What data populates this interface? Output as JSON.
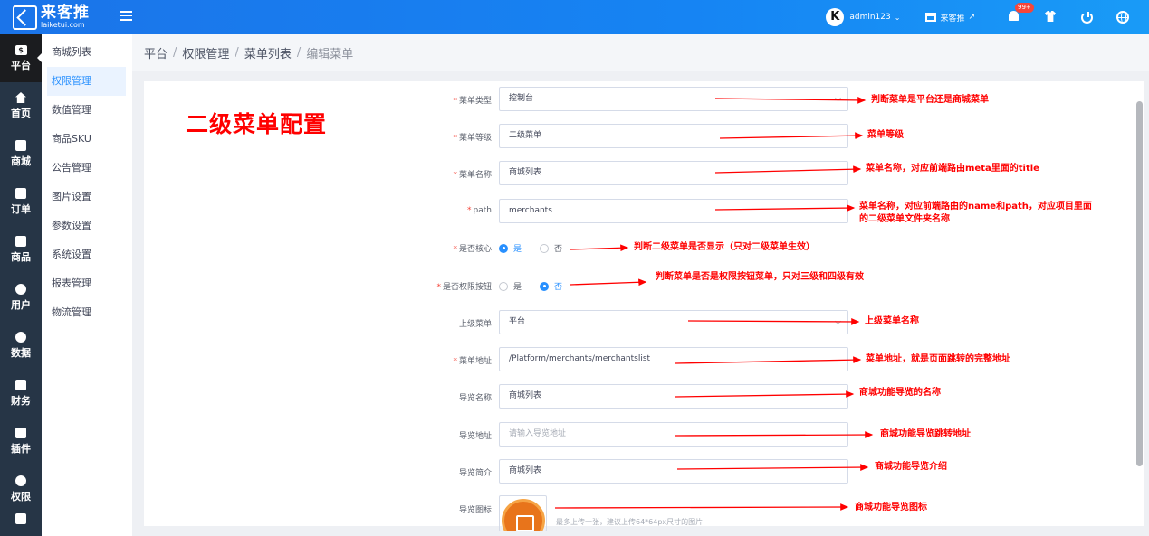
{
  "topbar": {
    "logo_name": "来客推",
    "logo_domain": "laiketui.com",
    "admin_avatar": "K",
    "admin_name": "admin123",
    "store_label": "来客推",
    "notification_badge": "99+",
    "icons": [
      "menu-icon",
      "chevron-down-icon",
      "store-icon",
      "external-link-icon",
      "bell-icon",
      "shirt-icon",
      "power-icon",
      "globe-icon"
    ]
  },
  "rail": [
    {
      "label": "平台",
      "icon": "dollar-icon",
      "active": true
    },
    {
      "label": "首页",
      "icon": "home-icon"
    },
    {
      "label": "商城",
      "icon": "store-icon"
    },
    {
      "label": "订单",
      "icon": "clipboard-icon"
    },
    {
      "label": "商品",
      "icon": "box-icon"
    },
    {
      "label": "用户",
      "icon": "user-icon"
    },
    {
      "label": "数据",
      "icon": "pie-chart-icon"
    },
    {
      "label": "财务",
      "icon": "wallet-icon"
    },
    {
      "label": "插件",
      "icon": "puzzle-icon"
    },
    {
      "label": "权限",
      "icon": "shield-icon"
    }
  ],
  "subnav": [
    {
      "label": "商城列表"
    },
    {
      "label": "权限管理",
      "active": true
    },
    {
      "label": "数值管理"
    },
    {
      "label": "商品SKU"
    },
    {
      "label": "公告管理"
    },
    {
      "label": "图片设置"
    },
    {
      "label": "参数设置"
    },
    {
      "label": "系统设置"
    },
    {
      "label": "报表管理"
    },
    {
      "label": "物流管理"
    }
  ],
  "breadcrumb": [
    "平台",
    "权限管理",
    "菜单列表",
    "编辑菜单"
  ],
  "page_title": "二级菜单配置",
  "form": {
    "menu_type": {
      "label": "菜单类型",
      "value": "控制台"
    },
    "menu_level": {
      "label": "菜单等级",
      "value": "二级菜单"
    },
    "menu_name": {
      "label": "菜单名称",
      "value": "商城列表"
    },
    "path": {
      "label": "path",
      "value": "merchants"
    },
    "is_core": {
      "label": "是否核心",
      "yes": "是",
      "no": "否",
      "selected": "是"
    },
    "is_permission_button": {
      "label": "是否权限按钮",
      "yes": "是",
      "no": "否",
      "selected": "否"
    },
    "parent_menu": {
      "label": "上级菜单",
      "value": "平台"
    },
    "menu_url": {
      "label": "菜单地址",
      "value": "/Platform/merchants/merchantslist"
    },
    "guide_name": {
      "label": "导览名称",
      "value": "商城列表"
    },
    "guide_url": {
      "label": "导览地址",
      "placeholder": "请输入导览地址"
    },
    "guide_intro": {
      "label": "导览简介",
      "value": "商城列表"
    },
    "guide_icon": {
      "label": "导览图标",
      "hint": "最多上传一张，建议上传64*64px尺寸的图片"
    }
  },
  "annotations": {
    "menu_type": "判断菜单是平台还是商城菜单",
    "menu_level": "菜单等级",
    "menu_name": "菜单名称，对应前端路由meta里面的title",
    "path_line1": "菜单名称，对应前端路由的name和path，对应项目里面",
    "path_line2": "的二级菜单文件夹名称",
    "is_core": "判断二级菜单是否显示（只对二级菜单生效）",
    "is_permission_button": "判断菜单是否是权限按钮菜单，只对三级和四级有效",
    "parent_menu": "上级菜单名称",
    "menu_url": "菜单地址，就是页面跳转的完整地址",
    "guide_name": "商城功能导览的名称",
    "guide_url": "商城功能导览跳转地址",
    "guide_intro": "商城功能导览介绍",
    "guide_icon": "商城功能导览图标"
  },
  "colors": {
    "topbar": "#1684f3",
    "rail": "#263546",
    "accent": "#2890ff",
    "annotation": "#ff0000"
  }
}
